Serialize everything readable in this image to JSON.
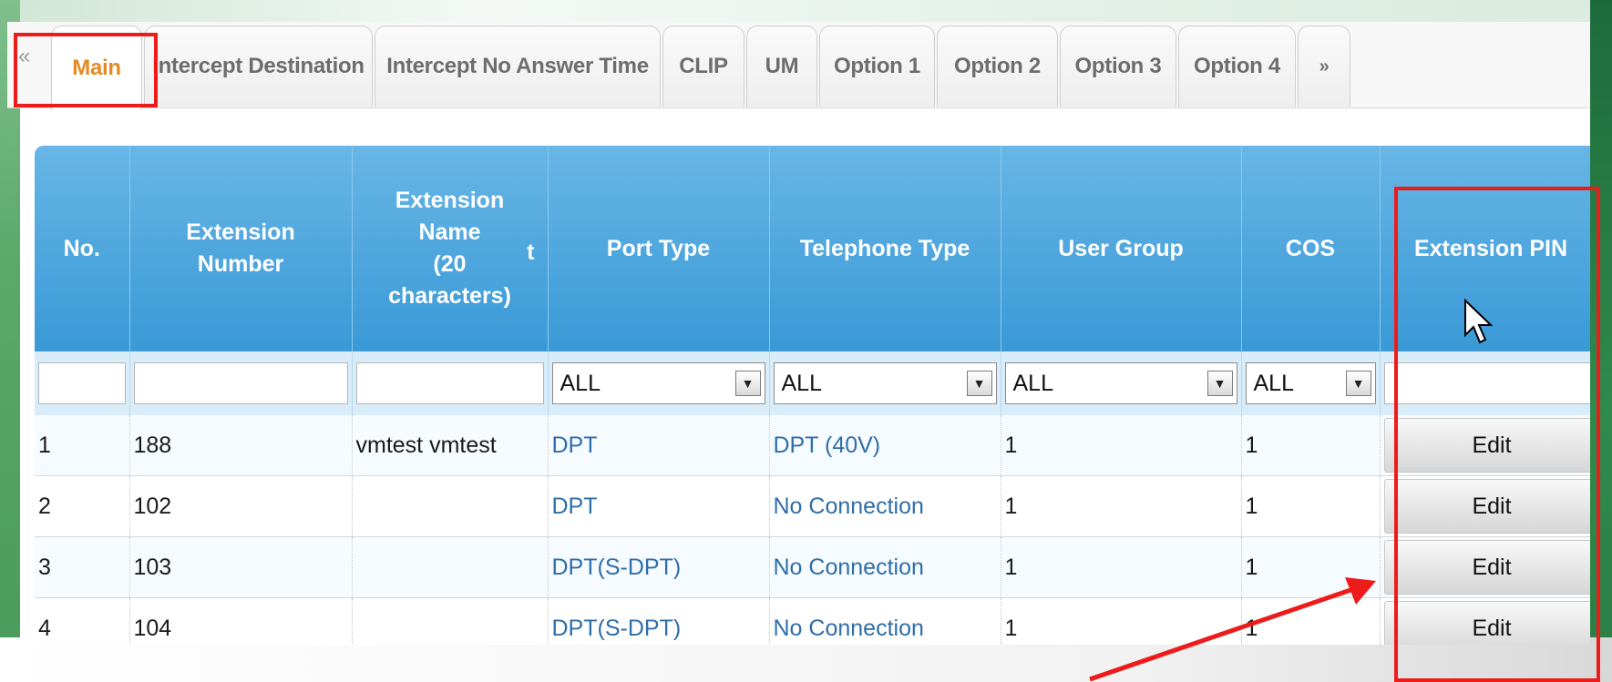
{
  "tabs": {
    "prev_label": "«",
    "next_label": "»",
    "items": [
      {
        "label": "Main",
        "active": true
      },
      {
        "label": "Intercept Destination",
        "active": false
      },
      {
        "label": "Intercept No Answer Time",
        "active": false
      },
      {
        "label": "CLIP",
        "active": false
      },
      {
        "label": "UM",
        "active": false
      },
      {
        "label": "Option 1",
        "active": false
      },
      {
        "label": "Option 2",
        "active": false
      },
      {
        "label": "Option 3",
        "active": false
      },
      {
        "label": "Option 4",
        "active": false
      }
    ]
  },
  "table": {
    "headers": {
      "no": "No.",
      "ext_number_1": "Extension",
      "ext_number_2": "Number",
      "ext_name_1": "Extension",
      "ext_name_2": "Name",
      "ext_name_3": "(20",
      "ext_name_4": "characters)",
      "ext_name_suffix": "t",
      "port_type": "Port Type",
      "telephone_type": "Telephone Type",
      "user_group": "User Group",
      "cos": "COS",
      "ext_pin": "Extension PIN"
    },
    "filters": {
      "port_type": "ALL",
      "telephone_type": "ALL",
      "user_group": "ALL",
      "cos": "ALL"
    },
    "rows": [
      {
        "no": "1",
        "number": "188",
        "name": "vmtest vmtest",
        "port": "DPT",
        "tel": "DPT (40V)",
        "group": "1",
        "cos": "1",
        "pin": "Edit"
      },
      {
        "no": "2",
        "number": "102",
        "name": "",
        "port": "DPT",
        "tel": "No Connection",
        "group": "1",
        "cos": "1",
        "pin": "Edit"
      },
      {
        "no": "3",
        "number": "103",
        "name": "",
        "port": "DPT(S-DPT)",
        "tel": "No Connection",
        "group": "1",
        "cos": "1",
        "pin": "Edit"
      },
      {
        "no": "4",
        "number": "104",
        "name": "",
        "port": "DPT(S-DPT)",
        "tel": "No Connection",
        "group": "1",
        "cos": "1",
        "pin": "Edit"
      }
    ]
  },
  "colors": {
    "header_blue": "#3a99d6",
    "active_tab": "#e58a23",
    "highlight_red": "#ee1b1b"
  }
}
